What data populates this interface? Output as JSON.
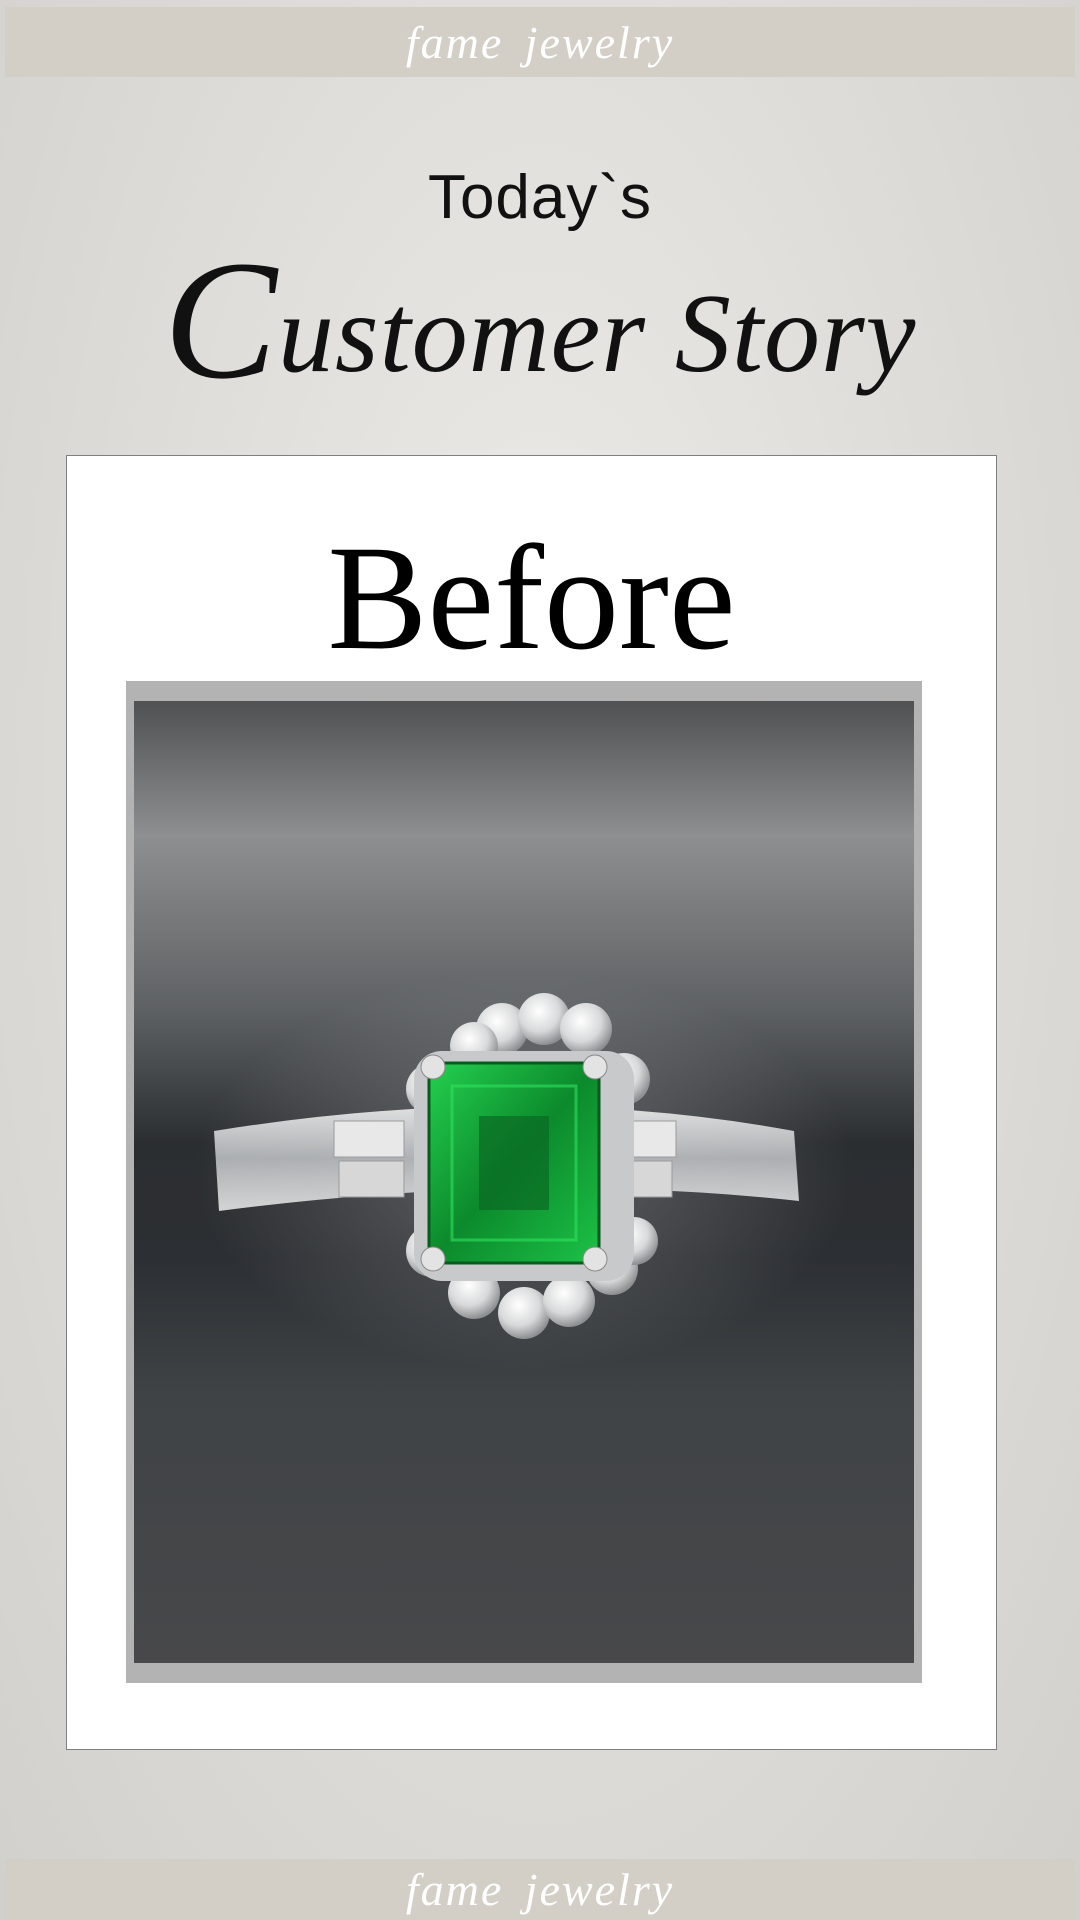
{
  "brand": {
    "top_label": "fame jewelry",
    "bottom_label": "fame jewelry",
    "bar_color": "#d3cfc7"
  },
  "heading": {
    "small": "Today`s",
    "script_initial": "C",
    "script_rest": "ustomer Story"
  },
  "card": {
    "title": "Before",
    "photo_alt": "Emerald-cut green emerald ring with diamond halo and baguette side stones",
    "gem_color": "#14a83a"
  }
}
